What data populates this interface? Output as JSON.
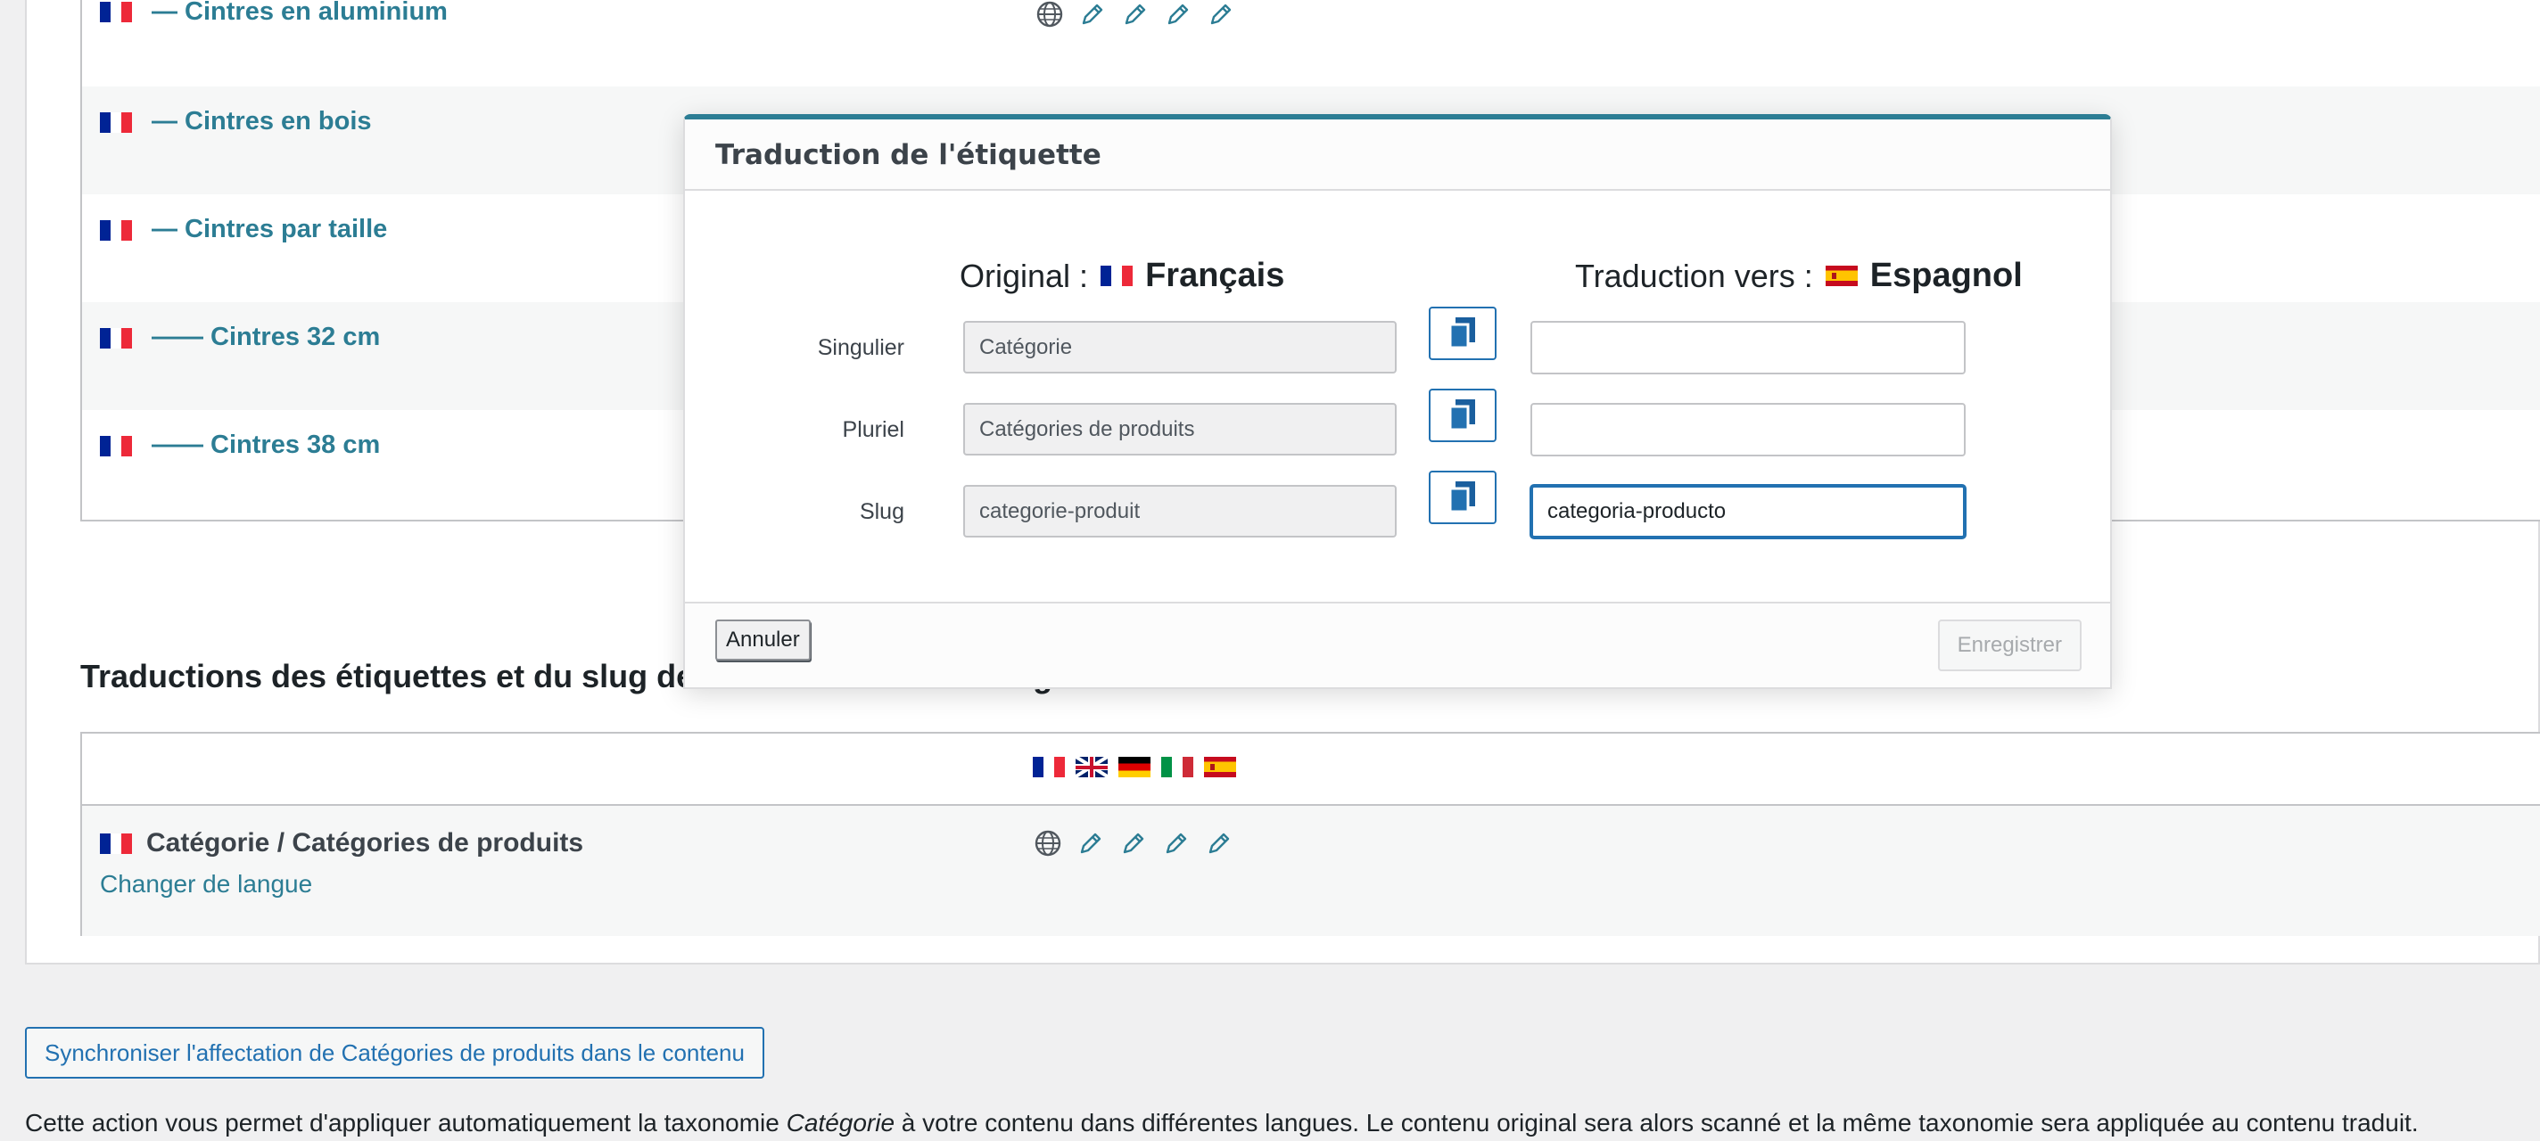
{
  "terms": [
    {
      "name": "— Cintres en aluminium",
      "lang_flag": "fr"
    },
    {
      "name": "— Cintres en bois",
      "lang_flag": "fr"
    },
    {
      "name": "— Cintres par taille",
      "lang_flag": "fr"
    },
    {
      "name": "—— Cintres 32 cm",
      "lang_flag": "fr"
    },
    {
      "name": "—— Cintres 38 cm",
      "lang_flag": "fr"
    }
  ],
  "labels_section": {
    "heading": "Traductions des étiquettes et du slug de la",
    "heading_suffix": "g",
    "language_flags": [
      "fr",
      "gb",
      "de",
      "it",
      "es"
    ],
    "row_title": "Catégorie / Catégories de produits",
    "change_language_link": "Changer de langue"
  },
  "sync": {
    "button_label": "Synchroniser l'affectation de Catégories de produits dans le contenu",
    "description_before": "Cette action vous permet d'appliquer automatiquement la taxonomie ",
    "description_em": "Catégorie",
    "description_after": " à votre contenu dans différentes langues. Le contenu original sera alors scanné et la même taxonomie sera appliquée au contenu traduit."
  },
  "modal": {
    "title": "Traduction de l'étiquette",
    "original_prefix": "Original :",
    "original_lang": "Français",
    "translation_prefix": "Traduction vers :",
    "translation_lang": "Espagnol",
    "fields": [
      {
        "label": "Singulier",
        "original": "Catégorie",
        "translation": ""
      },
      {
        "label": "Pluriel",
        "original": "Catégories de produits",
        "translation": ""
      },
      {
        "label": "Slug",
        "original": "categorie-produit",
        "translation": "categoria-producto"
      }
    ],
    "cancel_label": "Annuler",
    "save_label": "Enregistrer"
  },
  "colors": {
    "link": "#2c7d94",
    "accent": "#2271b1",
    "modal_top_border": "#2c7d94"
  },
  "icons": [
    "globe-icon",
    "pencil-icon"
  ]
}
